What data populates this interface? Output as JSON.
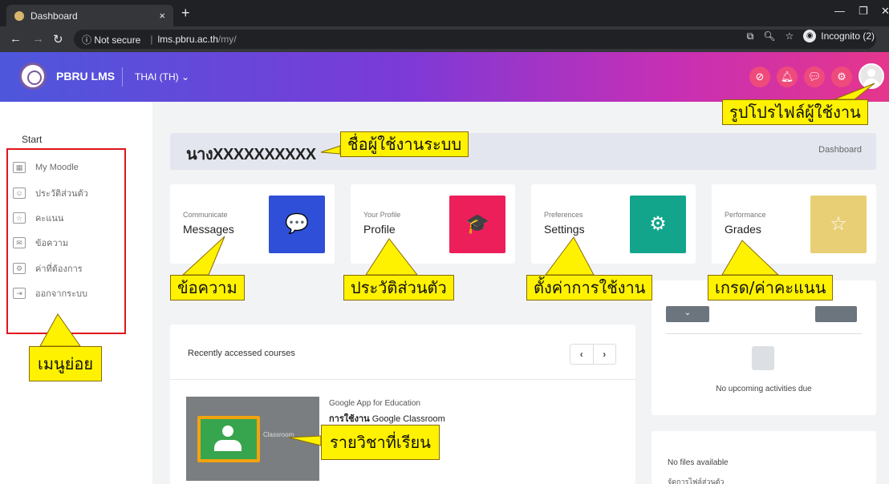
{
  "browser": {
    "tab_title": "Dashboard",
    "tab_close": "×",
    "new_tab": "+",
    "url_info": "ⓘ Not secure",
    "url_domain": "lms.pbru.ac.th",
    "url_path": "/my/",
    "incognito": "Incognito (2)"
  },
  "header": {
    "brand": "PBRU LMS",
    "language": "THAI (TH) ⌄"
  },
  "sidebar": {
    "start": "Start",
    "items": [
      {
        "label": "My Moodle",
        "icon": "dashboard-icon"
      },
      {
        "label": "ประวัติส่วนตัว",
        "icon": "profile-icon"
      },
      {
        "label": "คะแนน",
        "icon": "grades-icon"
      },
      {
        "label": "ข้อความ",
        "icon": "messages-icon"
      },
      {
        "label": "ค่าที่ต้องการ",
        "icon": "preferences-icon"
      },
      {
        "label": "ออกจากระบบ",
        "icon": "logout-icon"
      }
    ]
  },
  "page_header": {
    "username": "นางXXXXXXXXXX",
    "breadcrumb": "Dashboard"
  },
  "cards": [
    {
      "small": "Communicate",
      "big": "Messages",
      "color": "#2f4fd8",
      "icon": "message-icon",
      "glyph": "💬"
    },
    {
      "small": "Your Profile",
      "big": "Profile",
      "color": "#ed1f5a",
      "icon": "graduation-cap-icon",
      "glyph": "🎓"
    },
    {
      "small": "Preferences",
      "big": "Settings",
      "color": "#12a58c",
      "icon": "gear-icon",
      "glyph": "⚙"
    },
    {
      "small": "Performance",
      "big": "Grades",
      "color": "#e8cf75",
      "icon": "stars-icon",
      "glyph": "☆"
    }
  ],
  "courses": {
    "title": "Recently accessed courses",
    "prev": "‹",
    "next": "›",
    "category": "Google App for Education",
    "name_bold": "การใช้งาน",
    "name_rest": " Google Classroom",
    "thumb_text": "Classroom"
  },
  "timeline": {
    "sort_label": "⌄",
    "empty": "No upcoming activities due"
  },
  "files": {
    "empty": "No files available",
    "manage": "จัดการไฟล์ส่วนตัว"
  },
  "annotations": {
    "username_label": "ชื่อผู้ใช้งานระบบ",
    "avatar_label": "รูปโปรไฟล์ผู้ใช้งาน",
    "messages_label": "ข้อความ",
    "profile_label": "ประวัติส่วนตัว",
    "settings_label": "ตั้งค่าการใช้งาน",
    "grades_label": "เกรด/ค่าคะแนน",
    "menu_label": "เมนูย่อย",
    "course_label": "รายวิชาที่เรียน"
  }
}
